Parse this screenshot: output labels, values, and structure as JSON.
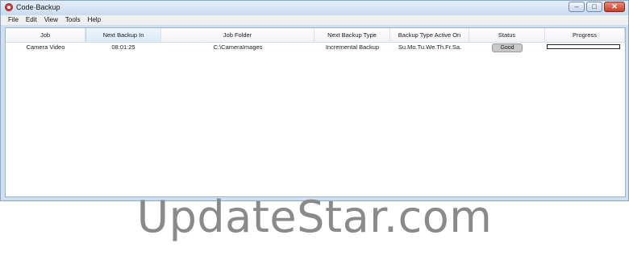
{
  "window": {
    "title": "Code·Backup",
    "buttons": {
      "minimize": "–",
      "maximize": "□",
      "close": "✕"
    }
  },
  "menu": [
    "File",
    "Edit",
    "View",
    "Tools",
    "Help"
  ],
  "table": {
    "columns": [
      "Job",
      "Next Backup In",
      "Job Folder",
      "Next Backup Type",
      "Backup Type Active On",
      "Status",
      "Progress"
    ],
    "rows": [
      {
        "job": "Camera Video",
        "next_backup_in": "08:01:25",
        "job_folder": "C:\\CameraImages",
        "next_backup_type": "Incremental Backup",
        "active_on": "Su.Mo.Tu.We.Th.Fr.Sa.",
        "status": "Good",
        "progress": 0
      }
    ]
  },
  "colors": {
    "progress_fill": "#3fae3f",
    "status_badge": "#c9c9c9"
  },
  "watermark": "UpdateStar.com"
}
